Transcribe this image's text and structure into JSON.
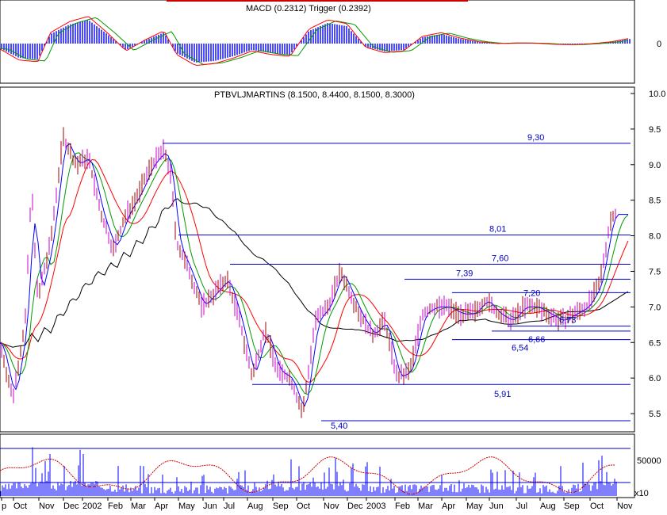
{
  "chart_data": [
    {
      "panel": "macd",
      "type": "bar",
      "title": "MACD (0.2312) Trigger (0.2392)",
      "yticks": [
        {
          "value": 0,
          "label": "0"
        }
      ],
      "ylim": [
        -1,
        1
      ],
      "series": [
        {
          "name": "MACD",
          "color": "#ff0000"
        },
        {
          "name": "Trigger",
          "color": "#009900"
        },
        {
          "name": "Histogram",
          "color": "#0000ff"
        }
      ],
      "histogram_points": [
        [
          0,
          -0.15
        ],
        [
          0.03,
          -0.45
        ],
        [
          0.06,
          -0.5
        ],
        [
          0.08,
          0.3
        ],
        [
          0.11,
          0.6
        ],
        [
          0.14,
          0.75
        ],
        [
          0.17,
          0.3
        ],
        [
          0.2,
          -0.2
        ],
        [
          0.23,
          0.1
        ],
        [
          0.26,
          0.35
        ],
        [
          0.28,
          -0.3
        ],
        [
          0.31,
          -0.6
        ],
        [
          0.34,
          -0.55
        ],
        [
          0.37,
          -0.4
        ],
        [
          0.4,
          -0.2
        ],
        [
          0.43,
          -0.3
        ],
        [
          0.46,
          -0.35
        ],
        [
          0.49,
          0.4
        ],
        [
          0.52,
          0.65
        ],
        [
          0.55,
          0.55
        ],
        [
          0.58,
          -0.1
        ],
        [
          0.61,
          -0.25
        ],
        [
          0.64,
          -0.2
        ],
        [
          0.67,
          0.2
        ],
        [
          0.7,
          0.3
        ],
        [
          0.73,
          0.15
        ],
        [
          0.76,
          0.05
        ],
        [
          0.79,
          0.0
        ],
        [
          0.82,
          0.02
        ],
        [
          0.85,
          0.01
        ],
        [
          0.88,
          -0.02
        ],
        [
          0.91,
          -0.03
        ],
        [
          0.94,
          0.0
        ],
        [
          0.97,
          0.05
        ],
        [
          1,
          0.15
        ]
      ]
    },
    {
      "panel": "price",
      "type": "line",
      "title": "PTBVLJMARTINS (8.1500, 8.4400, 8.1500, 8.3000)",
      "xlabel": "",
      "ylabel": "",
      "ylim": [
        5.3,
        10.0
      ],
      "x_ticks": [
        "p",
        "Oct",
        "Nov",
        "Dec",
        "2002",
        "Feb",
        "Mar",
        "Apr",
        "May",
        "Jun",
        "Jul",
        "Aug",
        "Sep",
        "Oct",
        "Nov",
        "Dec",
        "2003",
        "Feb",
        "Mar",
        "Apr",
        "May",
        "Jun",
        "Jul",
        "Aug",
        "Sep",
        "Oct",
        "Nov"
      ],
      "y_ticks": [
        "10.0",
        "9.5",
        "9.0",
        "8.5",
        "8.0",
        "7.5",
        "7.0",
        "6.5",
        "6.0",
        "5.5"
      ],
      "series": [
        {
          "name": "Price",
          "color": "#a00000",
          "points": [
            [
              0,
              6.5
            ],
            [
              0.02,
              5.7
            ],
            [
              0.04,
              6.8
            ],
            [
              0.05,
              8.7
            ],
            [
              0.06,
              7.1
            ],
            [
              0.08,
              7.9
            ],
            [
              0.1,
              9.4
            ],
            [
              0.12,
              9.0
            ],
            [
              0.14,
              9.1
            ],
            [
              0.16,
              8.3
            ],
            [
              0.18,
              7.8
            ],
            [
              0.2,
              8.3
            ],
            [
              0.22,
              8.6
            ],
            [
              0.24,
              9.0
            ],
            [
              0.26,
              9.2
            ],
            [
              0.27,
              8.9
            ],
            [
              0.28,
              7.9
            ],
            [
              0.3,
              7.5
            ],
            [
              0.32,
              7.0
            ],
            [
              0.34,
              7.2
            ],
            [
              0.36,
              7.4
            ],
            [
              0.38,
              6.8
            ],
            [
              0.4,
              6.0
            ],
            [
              0.42,
              6.7
            ],
            [
              0.44,
              6.1
            ],
            [
              0.46,
              6.0
            ],
            [
              0.48,
              5.5
            ],
            [
              0.5,
              6.8
            ],
            [
              0.52,
              7.0
            ],
            [
              0.54,
              7.5
            ],
            [
              0.55,
              7.3
            ],
            [
              0.57,
              6.9
            ],
            [
              0.59,
              6.6
            ],
            [
              0.61,
              6.8
            ],
            [
              0.63,
              6.0
            ],
            [
              0.65,
              6.1
            ],
            [
              0.67,
              6.9
            ],
            [
              0.69,
              7.0
            ],
            [
              0.71,
              7.0
            ],
            [
              0.73,
              6.9
            ],
            [
              0.75,
              6.9
            ],
            [
              0.77,
              7.1
            ],
            [
              0.79,
              6.9
            ],
            [
              0.81,
              6.8
            ],
            [
              0.83,
              7.0
            ],
            [
              0.85,
              7.0
            ],
            [
              0.87,
              6.9
            ],
            [
              0.89,
              6.8
            ],
            [
              0.91,
              6.9
            ],
            [
              0.93,
              7.0
            ],
            [
              0.95,
              7.3
            ],
            [
              0.97,
              8.3
            ]
          ]
        },
        {
          "name": "Moving Average 1",
          "color": "#0000ff"
        },
        {
          "name": "Moving Average 2",
          "color": "#009900"
        },
        {
          "name": "Moving Average 3",
          "color": "#ff0000"
        },
        {
          "name": "Moving Average 4",
          "color": "#000000"
        }
      ],
      "levels": [
        {
          "value": 9.3,
          "label": "9,30"
        },
        {
          "value": 8.01,
          "label": "8,01"
        },
        {
          "value": 7.6,
          "label": "7,60"
        },
        {
          "value": 7.39,
          "label": "7,39"
        },
        {
          "value": 7.2,
          "label": "7,20"
        },
        {
          "value": 6.73,
          "label": "6,73"
        },
        {
          "value": 6.66,
          "label": "6,66"
        },
        {
          "value": 6.54,
          "label": "6,54"
        },
        {
          "value": 5.91,
          "label": "5,91"
        },
        {
          "value": 5.4,
          "label": "5,40"
        }
      ]
    },
    {
      "panel": "volume",
      "type": "bar",
      "title": "",
      "y_ticks": [
        "50000"
      ],
      "x_multiplier": "x10",
      "series": [
        {
          "name": "Volume",
          "color": "#0000ff"
        },
        {
          "name": "Oscillator",
          "color": "#cc0000"
        }
      ],
      "volume_points": [
        [
          0,
          0.2
        ],
        [
          0.05,
          1.0
        ],
        [
          0.1,
          0.5
        ],
        [
          0.12,
          1.0
        ],
        [
          0.2,
          0.3
        ],
        [
          0.3,
          0.2
        ],
        [
          0.4,
          0.3
        ],
        [
          0.5,
          0.7
        ],
        [
          0.6,
          0.3
        ],
        [
          0.7,
          0.4
        ],
        [
          0.8,
          0.3
        ],
        [
          0.9,
          0.2
        ],
        [
          0.98,
          1.0
        ]
      ]
    }
  ]
}
